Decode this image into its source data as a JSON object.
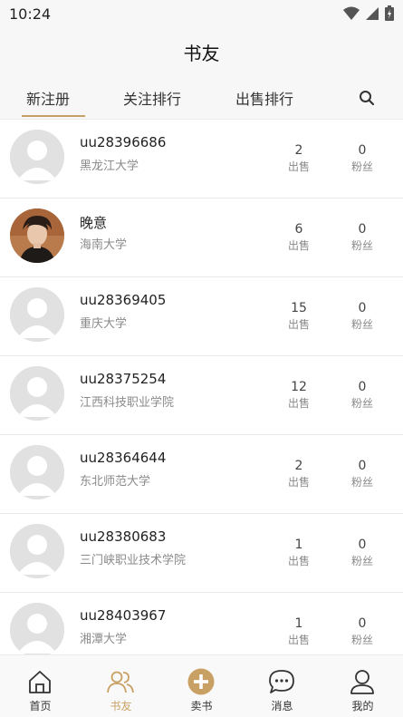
{
  "status_bar": {
    "time": "10:24"
  },
  "header": {
    "title": "书友"
  },
  "tabs": [
    {
      "label": "新注册",
      "active": true
    },
    {
      "label": "关注排行",
      "active": false
    },
    {
      "label": "出售排行",
      "active": false
    }
  ],
  "stat_labels": {
    "sales": "出售",
    "fans": "粉丝"
  },
  "users": [
    {
      "name": "uu28396686",
      "school": "黑龙江大学",
      "sales": "2",
      "fans": "0",
      "avatar": "default"
    },
    {
      "name": "晚意",
      "school": "海南大学",
      "sales": "6",
      "fans": "0",
      "avatar": "photo"
    },
    {
      "name": "uu28369405",
      "school": "重庆大学",
      "sales": "15",
      "fans": "0",
      "avatar": "default"
    },
    {
      "name": "uu28375254",
      "school": "江西科技职业学院",
      "sales": "12",
      "fans": "0",
      "avatar": "default"
    },
    {
      "name": "uu28364644",
      "school": "东北师范大学",
      "sales": "2",
      "fans": "0",
      "avatar": "default"
    },
    {
      "name": "uu28380683",
      "school": "三门峡职业技术学院",
      "sales": "1",
      "fans": "0",
      "avatar": "default"
    },
    {
      "name": "uu28403967",
      "school": "湘潭大学",
      "sales": "1",
      "fans": "0",
      "avatar": "default"
    }
  ],
  "bottom_nav": [
    {
      "label": "首页",
      "icon": "home-icon",
      "active": false
    },
    {
      "label": "书友",
      "icon": "friends-icon",
      "active": true
    },
    {
      "label": "卖书",
      "icon": "plus-circle-icon",
      "active": false
    },
    {
      "label": "消息",
      "icon": "chat-bubble-icon",
      "active": false
    },
    {
      "label": "我的",
      "icon": "profile-icon",
      "active": false
    }
  ],
  "colors": {
    "accent": "#c9a064",
    "avatar_bg": "#e1e1e1",
    "avatar_fg": "#ffffff"
  }
}
